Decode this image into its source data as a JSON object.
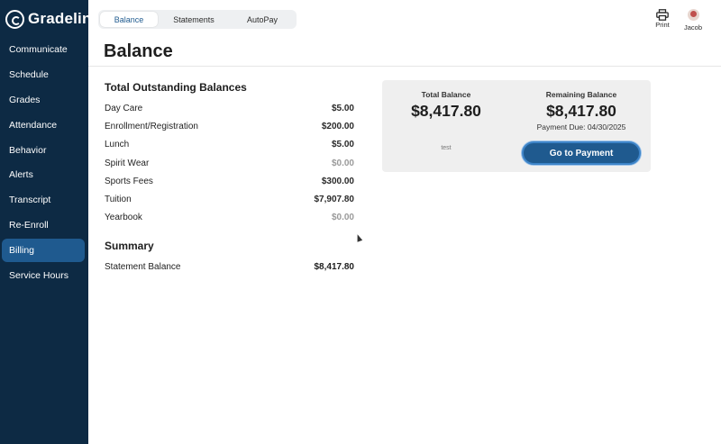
{
  "app": {
    "logo_text": "Gradelink"
  },
  "sidebar": {
    "items": [
      {
        "label": "Communicate"
      },
      {
        "label": "Schedule"
      },
      {
        "label": "Grades"
      },
      {
        "label": "Attendance"
      },
      {
        "label": "Behavior"
      },
      {
        "label": "Alerts"
      },
      {
        "label": "Transcript"
      },
      {
        "label": "Re-Enroll"
      },
      {
        "label": "Billing",
        "active": true
      },
      {
        "label": "Service Hours"
      }
    ]
  },
  "tabs": [
    {
      "label": "Balance",
      "active": true
    },
    {
      "label": "Statements"
    },
    {
      "label": "AutoPay"
    }
  ],
  "toolbar": {
    "print_label": "Print",
    "print_icon": "printer-icon",
    "user_name": "Jacob"
  },
  "page": {
    "title": "Balance"
  },
  "outstanding": {
    "title": "Total Outstanding Balances",
    "rows": [
      {
        "label": "Day Care",
        "amount": "$5.00"
      },
      {
        "label": "Enrollment/Registration",
        "amount": "$200.00"
      },
      {
        "label": "Lunch",
        "amount": "$5.00"
      },
      {
        "label": "Spirit Wear",
        "amount": "$0.00"
      },
      {
        "label": "Sports Fees",
        "amount": "$300.00"
      },
      {
        "label": "Tuition",
        "amount": "$7,907.80"
      },
      {
        "label": "Yearbook",
        "amount": "$0.00"
      }
    ]
  },
  "summary": {
    "title": "Summary",
    "statement_label": "Statement Balance",
    "statement_amount": "$8,417.80"
  },
  "card": {
    "total_label": "Total Balance",
    "total_value": "$8,417.80",
    "remaining_label": "Remaining Balance",
    "remaining_value": "$8,417.80",
    "payment_due": "Payment Due: 04/30/2025",
    "note": "test",
    "pay_button_label": "Go to Payment"
  },
  "colors": {
    "sidebar_bg": "#0d2a44",
    "accent": "#1f5a8f",
    "card_bg": "#efefef"
  }
}
